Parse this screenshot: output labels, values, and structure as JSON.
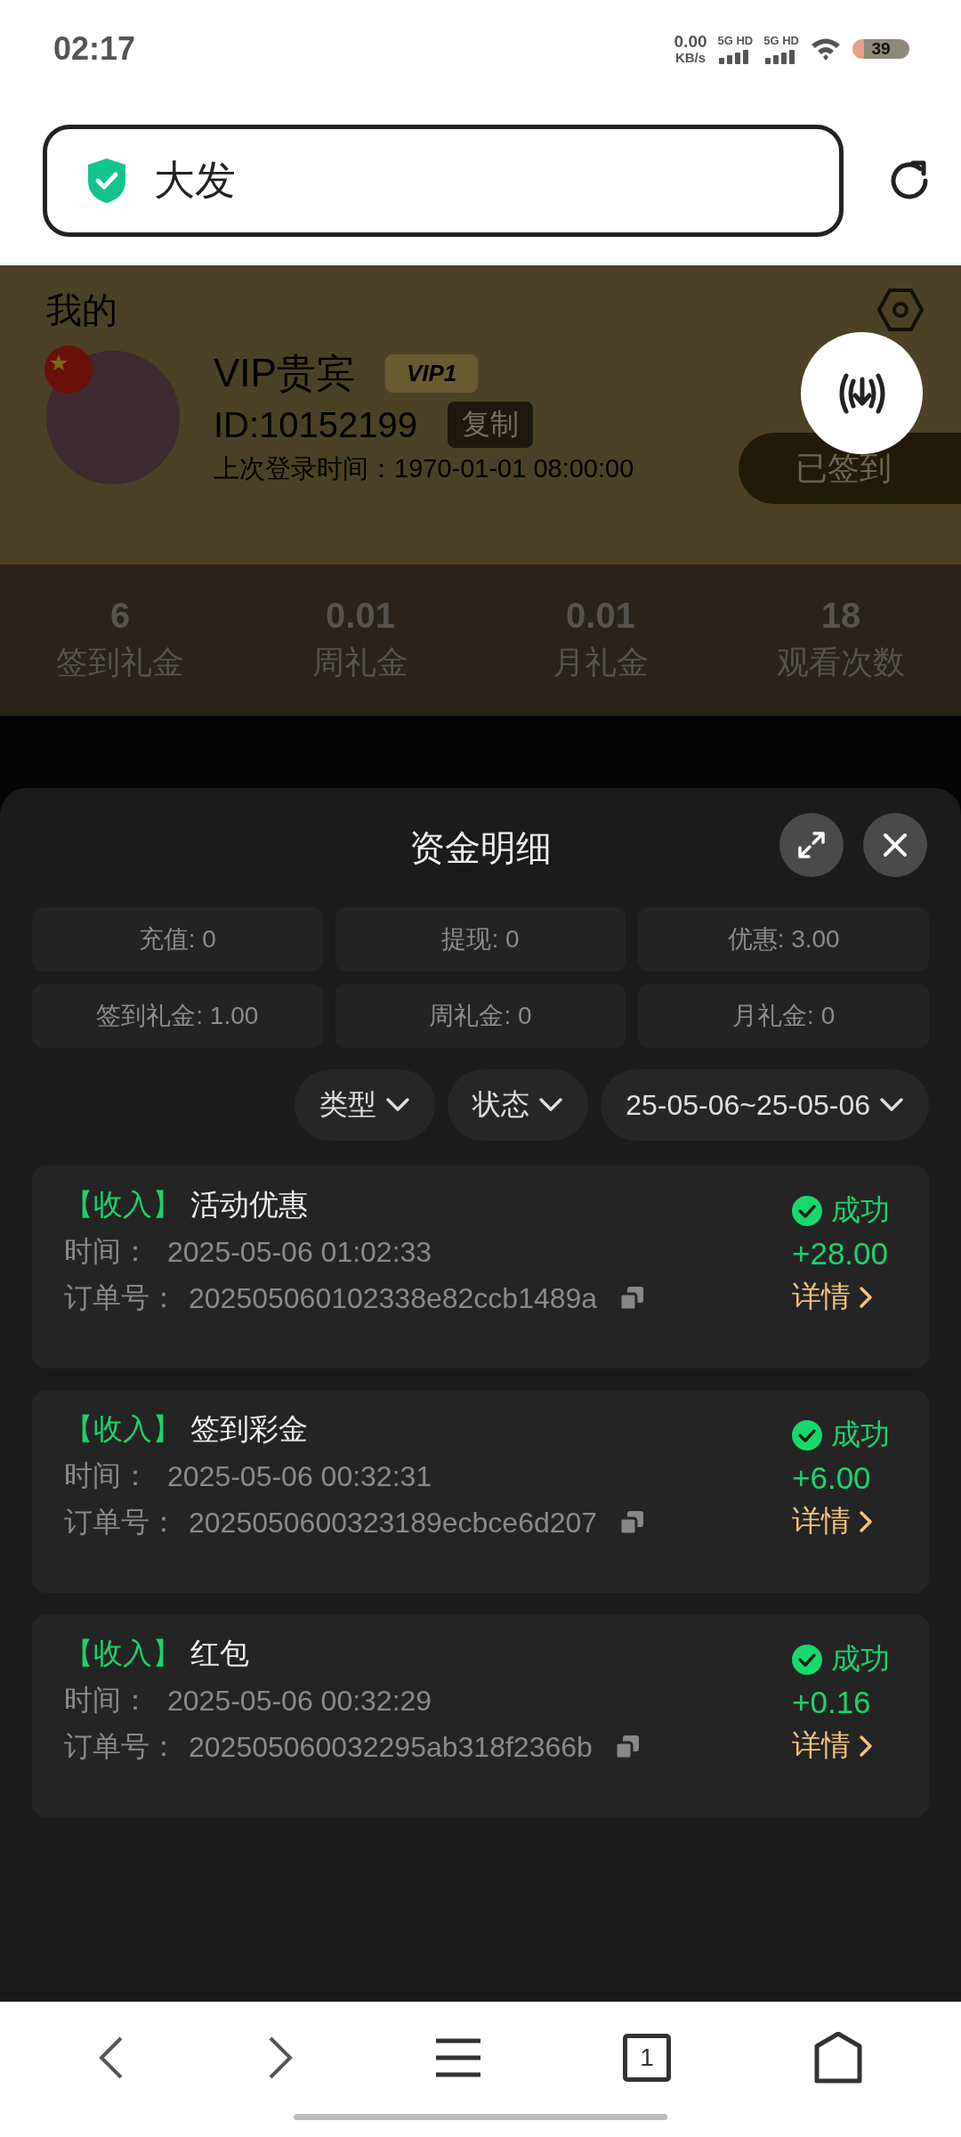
{
  "status_bar": {
    "time": "02:17",
    "net_speed_value": "0.00",
    "net_speed_unit": "KB/s",
    "sim_labels": [
      "5G HD",
      "5G HD"
    ],
    "battery": "39"
  },
  "address_bar": {
    "text": "大发"
  },
  "background_page": {
    "title": "我的",
    "name": "VIP贵宾",
    "vip_badge": "VIP1",
    "id": "ID:10152199",
    "copy_button": "复制",
    "last_login": "上次登录时间：1970-01-01 08:00:00",
    "checkin_button": "已签到",
    "stats": [
      {
        "value": "6",
        "label": "签到礼金"
      },
      {
        "value": "0.01",
        "label": "周礼金"
      },
      {
        "value": "0.01",
        "label": "月礼金"
      },
      {
        "value": "18",
        "label": "观看次数"
      }
    ]
  },
  "sheet": {
    "title": "资金明细",
    "summary": [
      "充值: 0",
      "提现: 0",
      "优惠: 3.00",
      "签到礼金: 1.00",
      "周礼金: 0",
      "月礼金: 0"
    ],
    "filters": [
      "类型",
      "状态",
      "25-05-06~25-05-06"
    ],
    "records": [
      {
        "tag": "【收入】",
        "title": "活动优惠",
        "time_label": "时间：",
        "time": "2025-05-06 01:02:33",
        "order_label": "订单号：",
        "order": "202505060102338e82ccb1489a",
        "status": "成功",
        "amount": "+28.00",
        "details": "详情"
      },
      {
        "tag": "【收入】",
        "title": "签到彩金",
        "time_label": "时间：",
        "time": "2025-05-06 00:32:31",
        "order_label": "订单号：",
        "order": "2025050600323189ecbce6d207",
        "status": "成功",
        "amount": "+6.00",
        "details": "详情"
      },
      {
        "tag": "【收入】",
        "title": "红包",
        "time_label": "时间：",
        "time": "2025-05-06 00:32:29",
        "order_label": "订单号：",
        "order": "202505060032295ab318f2366b",
        "status": "成功",
        "amount": "+0.16",
        "details": "详情"
      }
    ]
  },
  "bottom_nav": {
    "tab_count": "1"
  }
}
